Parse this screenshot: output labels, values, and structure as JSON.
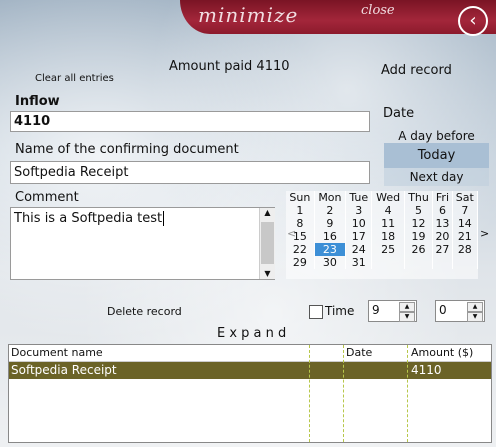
{
  "window": {
    "minimize_label": "minimize",
    "close_label": "close",
    "back_icon": "back-arrow-icon"
  },
  "summary": {
    "clear_all_label": "Clear all entries",
    "amount_paid_text": "Amount paid 4110",
    "add_record_label": "Add record"
  },
  "inflow": {
    "label": "Inflow",
    "value": "4110"
  },
  "document": {
    "label": "Name of the confirming document",
    "value": "Softpedia Receipt"
  },
  "comment": {
    "label": "Comment",
    "value": "This is a Softpedia test"
  },
  "date": {
    "label": "Date",
    "day_before_label": "A day before",
    "today_label": "Today",
    "next_day_label": "Next day"
  },
  "calendar": {
    "prev_icon": "<",
    "next_icon": ">",
    "weekdays": [
      "Sun",
      "Mon",
      "Tue",
      "Wed",
      "Thu",
      "Fri",
      "Sat"
    ],
    "weeks": [
      [
        "1",
        "2",
        "3",
        "4",
        "5",
        "6",
        "7"
      ],
      [
        "8",
        "9",
        "10",
        "11",
        "12",
        "13",
        "14"
      ],
      [
        "15",
        "16",
        "17",
        "18",
        "19",
        "20",
        "21"
      ],
      [
        "22",
        "23",
        "24",
        "25",
        "26",
        "27",
        "28"
      ],
      [
        "29",
        "30",
        "31",
        "",
        "",
        "",
        ""
      ]
    ],
    "selected_day": "23"
  },
  "controls": {
    "delete_record_label": "Delete record",
    "time_label": "Time",
    "time_checked": false,
    "hour_value": "9",
    "minute_value": "0",
    "expand_label": "E x p a n d"
  },
  "grid": {
    "columns": [
      "Document name",
      "",
      "Date",
      "Amount ($)"
    ],
    "rows": [
      {
        "document_name": "Softpedia Receipt",
        "date": "",
        "amount": "4110"
      }
    ]
  }
}
